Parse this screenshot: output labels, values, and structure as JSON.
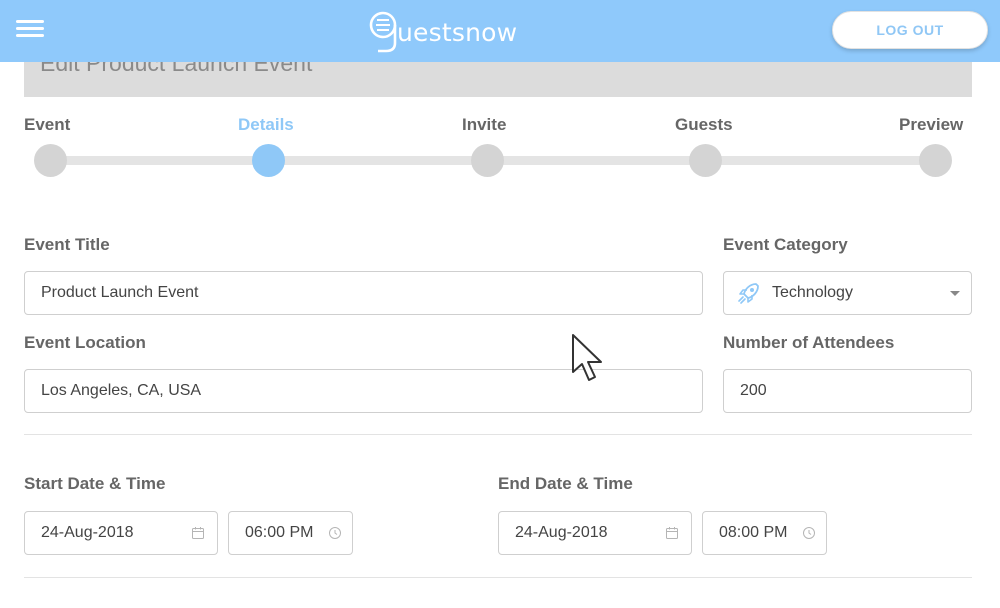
{
  "topbar": {
    "brand": "uestsnow",
    "logout_label": "LOG OUT"
  },
  "header": {
    "title": "Edit Product Launch Event"
  },
  "steps": [
    {
      "label": "Event"
    },
    {
      "label": "Details"
    },
    {
      "label": "Invite"
    },
    {
      "label": "Guests"
    },
    {
      "label": "Preview"
    }
  ],
  "active_step": "Details",
  "form": {
    "event_title": {
      "label": "Event Title",
      "value": "Product Launch Event"
    },
    "event_category": {
      "label": "Event Category",
      "value": "Technology",
      "icon": "rocket-icon"
    },
    "event_location": {
      "label": "Event Location",
      "value": "Los Angeles, CA, USA"
    },
    "attendees": {
      "label": "Number of Attendees",
      "value": "200"
    },
    "start": {
      "label": "Start Date & Time",
      "date": "24-Aug-2018",
      "time": "06:00 PM"
    },
    "end": {
      "label": "End Date & Time",
      "date": "24-Aug-2018",
      "time": "08:00 PM"
    }
  },
  "colors": {
    "topbar": "#8fc9fb",
    "accent": "#8fc8f7",
    "inactive": "#d4d4d4"
  }
}
